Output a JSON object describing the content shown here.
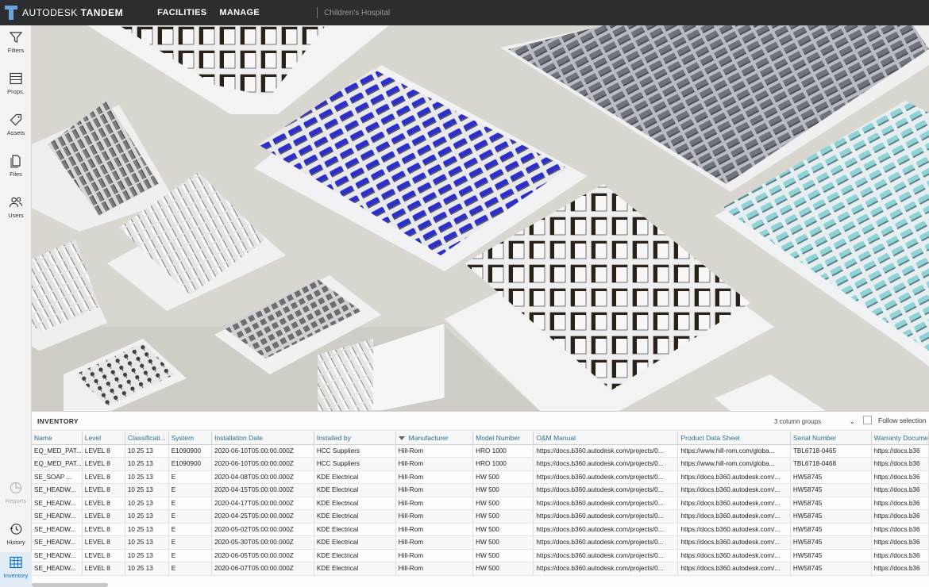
{
  "topbar": {
    "brand_light": "AUTODESK",
    "brand_bold": "TANDEM",
    "nav": [
      "FACILITIES",
      "MANAGE"
    ],
    "facility": "Children's Hospital"
  },
  "sidebar": {
    "items": [
      {
        "label": "Filters",
        "icon": "filter-icon"
      },
      {
        "label": "Props.",
        "icon": "properties-icon"
      },
      {
        "label": "Assets",
        "icon": "tag-icon"
      },
      {
        "label": "Files",
        "icon": "files-icon"
      },
      {
        "label": "Users",
        "icon": "users-icon"
      },
      {
        "label": "Reports",
        "icon": "pie-chart-icon"
      },
      {
        "label": "History",
        "icon": "clock-icon"
      },
      {
        "label": "Inventory",
        "icon": "table-icon"
      }
    ]
  },
  "inventory": {
    "title": "INVENTORY",
    "column_groups": "3 column groups",
    "follow_selection": "Follow selection",
    "columns": [
      "Name",
      "Level",
      "Classificati...",
      "System",
      "Installation Date",
      "Installed by",
      "Manufacturer",
      "Model Number",
      "O&M Manual",
      "Product Data Sheet",
      "Serial Number",
      "Warranty Docume"
    ],
    "rows": [
      [
        "EQ_MED_PAT...",
        "LEVEL 8",
        "10 25 13",
        "E1090900",
        "2020-06-10T05:00:00.000Z",
        "HCC Suppliers",
        "Hill-Rom",
        "HRO 1000",
        "https://docs.b360.autodesk.com/projects/0...",
        "https://www.hill-rom.com/globa...",
        "TBL6718-0465",
        "https://docs.b36"
      ],
      [
        "EQ_MED_PAT...",
        "LEVEL 8",
        "10 25 13",
        "E1090900",
        "2020-06-10T05:00:00.000Z",
        "HCC Suppliers",
        "Hill-Rom",
        "HRO 1000",
        "https://docs.b360.autodesk.com/projects/0...",
        "https://www.hill-rom.com/globa...",
        "TBL6718-0468",
        "https://docs.b36"
      ],
      [
        "SE_SOAP ...",
        "LEVEL 8",
        "10 25 13",
        "E",
        "2020-04-08T05:00:00.000Z",
        "KDE Electrical",
        "Hill-Rom",
        "HW 500",
        "https://docs.b360.autodesk.com/projects/0...",
        "https://docs.b360.autodesk.com/...",
        "HW58745",
        "https://docs.b36"
      ],
      [
        "SE_HEADW...",
        "LEVEL 8",
        "10 25 13",
        "E",
        "2020-04-15T05:00:00.000Z",
        "KDE Electrical",
        "Hill-Rom",
        "HW 500",
        "https://docs.b360.autodesk.com/projects/0...",
        "https://docs.b360.autodesk.com/...",
        "HW58745",
        "https://docs.b36"
      ],
      [
        "SE_HEADW...",
        "LEVEL 8",
        "10 25 13",
        "E",
        "2020-04-17T05:00:00.000Z",
        "KDE Electrical",
        "Hill-Rom",
        "HW 500",
        "https://docs.b360.autodesk.com/projects/0...",
        "https://docs.b360.autodesk.com/...",
        "HW58745",
        "https://docs.b36"
      ],
      [
        "SE_HEADW...",
        "LEVEL 8",
        "10 25 13",
        "E",
        "2020-04-25T05:00:00.000Z",
        "KDE Electrical",
        "Hill-Rom",
        "HW 500",
        "https://docs.b360.autodesk.com/projects/0...",
        "https://docs.b360.autodesk.com/...",
        "HW58745",
        "https://docs.b36"
      ],
      [
        "SE_HEADW...",
        "LEVEL 8",
        "10 25 13",
        "E",
        "2020-05-02T05:00:00.000Z",
        "KDE Electrical",
        "Hill-Rom",
        "HW 500",
        "https://docs.b360.autodesk.com/projects/0...",
        "https://docs.b360.autodesk.com/...",
        "HW58745",
        "https://docs.b36"
      ],
      [
        "SE_HEADW...",
        "LEVEL 8",
        "10 25 13",
        "E",
        "2020-05-30T05:00:00.000Z",
        "KDE Electrical",
        "Hill-Rom",
        "HW 500",
        "https://docs.b360.autodesk.com/projects/0...",
        "https://docs.b360.autodesk.com/...",
        "HW58745",
        "https://docs.b36"
      ],
      [
        "SE_HEADW...",
        "LEVEL 8",
        "10 25 13",
        "E",
        "2020-06-05T05:00:00.000Z",
        "KDE Electrical",
        "Hill-Rom",
        "HW 500",
        "https://docs.b360.autodesk.com/projects/0...",
        "https://docs.b360.autodesk.com/...",
        "HW58745",
        "https://docs.b36"
      ],
      [
        "SE_HEADW...",
        "LEVEL 8",
        "10 25 13",
        "E",
        "2020-06-07T05:00:00.000Z",
        "KDE Electrical",
        "Hill-Rom",
        "HW 500",
        "https://docs.b360.autodesk.com/projects/0...",
        "https://docs.b360.autodesk.com/...",
        "HW58745",
        "https://docs.b36"
      ]
    ]
  },
  "colors": {
    "topbar": "#2c2d30",
    "accent": "#0b6fc0",
    "bed_blue": "#2a2ec9",
    "bed_teal": "#8fd3d9"
  }
}
